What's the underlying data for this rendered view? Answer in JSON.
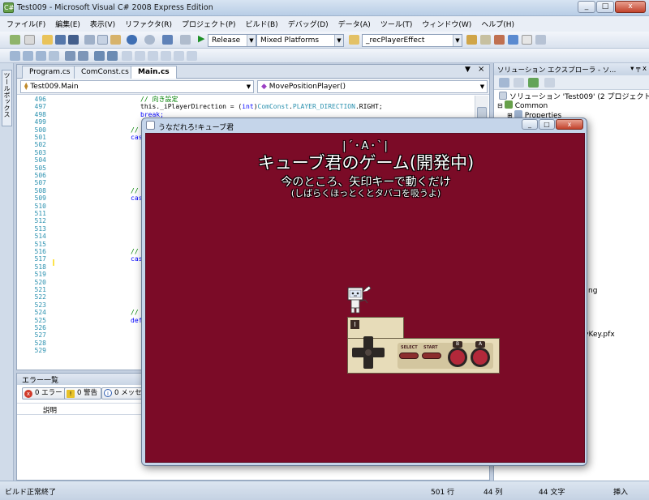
{
  "window": {
    "title": "Test009 - Microsoft Visual C# 2008 Express Edition",
    "minimize": "_",
    "maximize": "□",
    "close": "x"
  },
  "menu": [
    "ファイル(F)",
    "編集(E)",
    "表示(V)",
    "リファクタ(R)",
    "プロジェクト(P)",
    "ビルド(B)",
    "デバッグ(D)",
    "データ(A)",
    "ツール(T)",
    "ウィンドウ(W)",
    "ヘルプ(H)"
  ],
  "toolbar": {
    "configuration": "Release",
    "platform": "Mixed Platforms",
    "find_combo": "_recPlayerEffect"
  },
  "toolbox_tab": "ツールボックス",
  "editor": {
    "tabs": [
      "Program.cs",
      "ComConst.cs",
      "Main.cs"
    ],
    "active_tab": "Main.cs",
    "tab_dropdown": "▼",
    "tab_close": "×",
    "class_combo": "Test009.Main",
    "member_combo": "MovePositionPlayer()",
    "line_numbers": [
      "496",
      "497",
      "498",
      "499",
      "500",
      "501",
      "502",
      "503",
      "504",
      "505",
      "506",
      "507",
      "508",
      "509",
      "510",
      "511",
      "512",
      "513",
      "514",
      "515",
      "516",
      "517",
      "518",
      "519",
      "520",
      "521",
      "522",
      "523",
      "524",
      "525",
      "526",
      "527",
      "528",
      "529"
    ],
    "code_lines": {
      "l496": "// 向き設定",
      "l497a": "this._iPlayerDirection = (",
      "l497b": "int",
      "l497c": ")",
      "l497d": "ComConst",
      "l497e": ".",
      "l497f": "PLAYER_DIRECTION",
      "l497g": ".RIGHT;",
      "l498": "break;",
      "l500": "//",
      "l501": "cas",
      "l508": "//",
      "l509": "cas",
      "l516": "//",
      "l517": "cas",
      "l524": "//",
      "l525": "def"
    }
  },
  "error_list": {
    "title": "エラー一覧",
    "errors_btn": "0 エラー",
    "warnings_btn": "0 警告",
    "messages_btn": "0 メッセー",
    "col_description": "説明"
  },
  "solution_explorer": {
    "title": "ソリューション エクスプローラ - ソ...",
    "pin": "▾ ╤ x",
    "solution_node": "ソリューション 'Test009' (2 プロジェクト)",
    "common_node": "Common",
    "properties_node": "Properties",
    "partial_1": "t",
    "partial_2": "ng",
    "partial_3": "aryKey.pfx"
  },
  "status": {
    "message": "ビルド正常終了",
    "line": "501 行",
    "col": "44 列",
    "chars": "44 文字",
    "mode": "挿入"
  },
  "game": {
    "window_title": "うなだれろ!キューブ君",
    "face_line": "|´･A･`|",
    "title": "キューブ君のゲーム(開発中)",
    "subtitle": "今のところ、矢印キーで動くだけ",
    "subtitle2": "(しばらくほっとくとタバコを吸うよ)",
    "controller_badge": "I",
    "select_label": "SELECT",
    "start_label": "START",
    "b_label": "B",
    "a_label": "A"
  },
  "colors": {
    "game_background": "#7b0b27",
    "controller_body": "#e7dcb9",
    "controller_button": "#b3283a"
  }
}
